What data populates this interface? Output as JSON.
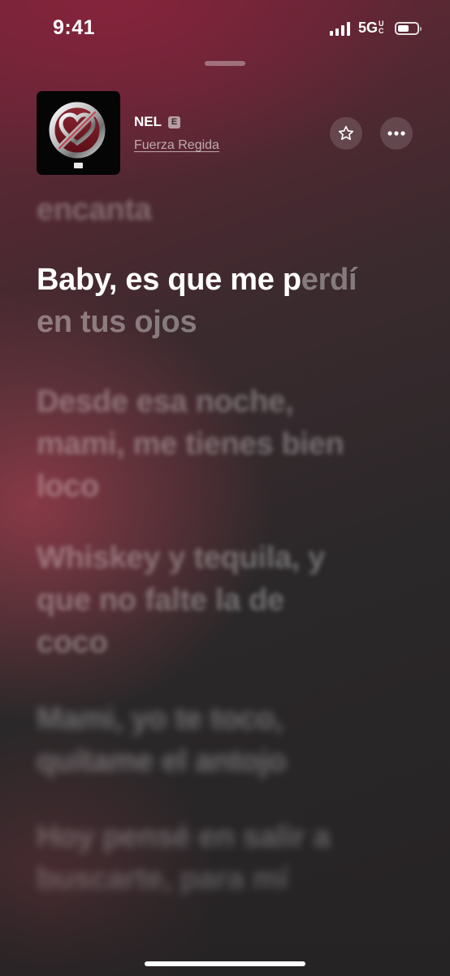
{
  "status_bar": {
    "time": "9:41",
    "network": "5G",
    "network_suffix": "UC",
    "battery_level": 0.6
  },
  "now_playing": {
    "title": "NEL",
    "explicit_badge": "E",
    "artist": "Fuerza Regida",
    "artwork_icon": "crossed-heart-chrome-art",
    "favorite_icon": "star-icon",
    "more_icon": "ellipsis-icon"
  },
  "lyrics": {
    "previous": "encanta",
    "current": {
      "sung": "Baby, es que me p",
      "unsung": "erdí en tus ojos"
    },
    "upcoming": [
      "Desde esa noche, mami, me tienes bien loco",
      "Whiskey y tequila, y que no falte la de coco",
      "Mami, yo te toco, quítame el antojo",
      "Hoy pensé en salir a buscarte, para mí"
    ]
  },
  "colors": {
    "background_accent": "#8a2a3f",
    "background_dark": "#262324",
    "text_primary": "#ffffff"
  }
}
